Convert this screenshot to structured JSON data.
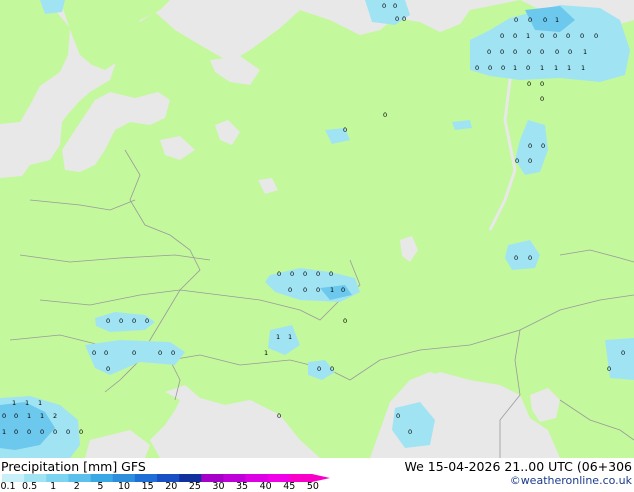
{
  "footer": {
    "title_left": "Precipitation [mm] GFS",
    "title_right": "We 15-04-2026 21..00 UTC (06+306",
    "copyright": "©weatheronline.co.uk"
  },
  "legend": {
    "labels": [
      "0.1",
      "0.5",
      "1",
      "2",
      "5",
      "10",
      "15",
      "20",
      "25",
      "30",
      "35",
      "40",
      "45",
      "50"
    ],
    "colors": [
      "#c8f0f8",
      "#a0e4f4",
      "#7cd4f0",
      "#5cc0ec",
      "#3aa8e4",
      "#2d8fdc",
      "#1e6ed6",
      "#1850c4",
      "#12309c",
      "#a400c8",
      "#c000d8",
      "#dc00e4",
      "#f000e8",
      "#f800c8"
    ]
  },
  "map": {
    "colors": {
      "sea": "#e8e8e8",
      "land": "#c4f89c",
      "border": "#9a9a9a",
      "precip": "#a0e4f4",
      "precip_heavy": "#6cc8ec"
    },
    "values": [
      {
        "t": "0"
      },
      {
        "t": "0"
      },
      {
        "t": "0"
      },
      {
        "t": "0"
      },
      {
        "t": "0"
      },
      {
        "t": "0"
      },
      {
        "t": "0"
      },
      {
        "t": "1"
      },
      {
        "t": "0"
      },
      {
        "t": "0"
      },
      {
        "t": "1"
      },
      {
        "t": "0"
      },
      {
        "t": "0"
      },
      {
        "t": "0"
      },
      {
        "t": "0"
      },
      {
        "t": "0"
      },
      {
        "t": "0"
      },
      {
        "t": "0"
      },
      {
        "t": "0"
      },
      {
        "t": "0"
      },
      {
        "t": "0"
      },
      {
        "t": "0"
      },
      {
        "t": "0"
      },
      {
        "t": "1"
      },
      {
        "t": "0"
      },
      {
        "t": "0"
      },
      {
        "t": "0"
      },
      {
        "t": "1"
      },
      {
        "t": "0"
      },
      {
        "t": "1"
      },
      {
        "t": "1"
      },
      {
        "t": "1"
      },
      {
        "t": "1"
      },
      {
        "t": "0"
      },
      {
        "t": "0"
      },
      {
        "t": "0"
      },
      {
        "t": "0"
      },
      {
        "t": "0"
      },
      {
        "t": "0"
      },
      {
        "t": "0"
      },
      {
        "t": "0"
      },
      {
        "t": "0"
      },
      {
        "t": "0"
      },
      {
        "t": "0"
      },
      {
        "t": "0"
      },
      {
        "t": "0"
      },
      {
        "t": "0"
      },
      {
        "t": "0"
      },
      {
        "t": "0"
      },
      {
        "t": "0"
      },
      {
        "t": "0"
      },
      {
        "t": "1"
      },
      {
        "t": "0"
      },
      {
        "t": "0"
      },
      {
        "t": "0"
      },
      {
        "t": "0"
      },
      {
        "t": "0"
      },
      {
        "t": "0"
      },
      {
        "t": "0"
      },
      {
        "t": "0"
      },
      {
        "t": "0"
      },
      {
        "t": "0"
      },
      {
        "t": "0"
      },
      {
        "t": "1"
      },
      {
        "t": "1"
      },
      {
        "t": "1"
      },
      {
        "t": "0"
      },
      {
        "t": "0"
      },
      {
        "t": "0"
      },
      {
        "t": "0"
      },
      {
        "t": "1"
      },
      {
        "t": "1"
      },
      {
        "t": "1"
      },
      {
        "t": "0"
      },
      {
        "t": "0"
      },
      {
        "t": "1"
      },
      {
        "t": "1"
      },
      {
        "t": "2"
      },
      {
        "t": "1"
      },
      {
        "t": "0"
      },
      {
        "t": "0"
      },
      {
        "t": "0"
      },
      {
        "t": "0"
      },
      {
        "t": "0"
      },
      {
        "t": "0"
      },
      {
        "t": "0"
      },
      {
        "t": "0"
      },
      {
        "t": "0"
      },
      {
        "t": "0"
      },
      {
        "t": "0"
      },
      {
        "t": "1"
      }
    ]
  }
}
